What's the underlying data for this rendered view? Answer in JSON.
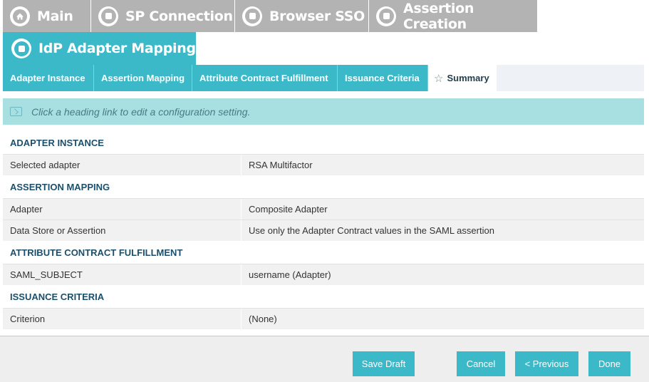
{
  "wizard_tabs": [
    {
      "label": "Main",
      "icon": "home-icon"
    },
    {
      "label": "SP Connection",
      "icon": "step-icon"
    },
    {
      "label": "Browser SSO",
      "icon": "step-icon"
    },
    {
      "label": "Assertion Creation",
      "icon": "step-icon"
    }
  ],
  "active_tab": {
    "label": "IdP Adapter Mapping",
    "icon": "step-icon"
  },
  "sub_tabs": [
    {
      "label": "Adapter Instance"
    },
    {
      "label": "Assertion Mapping"
    },
    {
      "label": "Attribute Contract Fulfillment"
    },
    {
      "label": "Issuance Criteria"
    },
    {
      "label": "Summary",
      "icon": "star-icon",
      "current": true
    }
  ],
  "info": {
    "text": "Click a heading link to edit a configuration setting.",
    "icon": "info-panel-icon"
  },
  "sections": [
    {
      "heading": "ADAPTER INSTANCE",
      "rows": [
        {
          "key": "Selected adapter",
          "value": "RSA Multifactor"
        }
      ]
    },
    {
      "heading": "ASSERTION MAPPING",
      "rows": [
        {
          "key": "Adapter",
          "value": "Composite Adapter"
        },
        {
          "key": "Data Store or Assertion",
          "value": "Use only the Adapter Contract values in the SAML assertion"
        }
      ]
    },
    {
      "heading": "ATTRIBUTE CONTRACT FULFILLMENT",
      "rows": [
        {
          "key": "SAML_SUBJECT",
          "value": "username (Adapter)"
        }
      ]
    },
    {
      "heading": "ISSUANCE CRITERIA",
      "rows": [
        {
          "key": "Criterion",
          "value": "(None)"
        }
      ]
    }
  ],
  "footer": {
    "save_draft": "Save Draft",
    "cancel": "Cancel",
    "previous": "< Previous",
    "done": "Done"
  },
  "colors": {
    "accent": "#3cb9c9",
    "inactive_tab": "#b3b3b3",
    "info_bg": "#a8e0e2",
    "heading": "#1c4f6b"
  }
}
